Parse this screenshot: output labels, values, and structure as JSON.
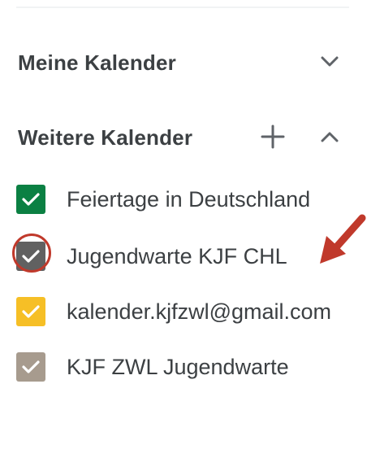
{
  "sidebar": {
    "my_calendars": {
      "label": "Meine Kalender",
      "toggle_icon": "chevron-down-icon"
    },
    "other_calendars": {
      "label": "Weitere Kalender",
      "add_icon": "plus-icon",
      "toggle_icon": "chevron-up-icon",
      "items": [
        {
          "label": "Feiertage in Deutschland",
          "color": "#0b8043",
          "checked": true
        },
        {
          "label": "Jugendwarte KJF CHL",
          "color": "#616161",
          "checked": true
        },
        {
          "label": "kalender.kjfzwl@gmail.com",
          "color": "#f6bf26",
          "checked": true
        },
        {
          "label": "KJF ZWL Jugendwarte",
          "color": "#a79b8e",
          "checked": true
        }
      ]
    }
  },
  "annotation": {
    "highlight_color": "#c0392b"
  }
}
